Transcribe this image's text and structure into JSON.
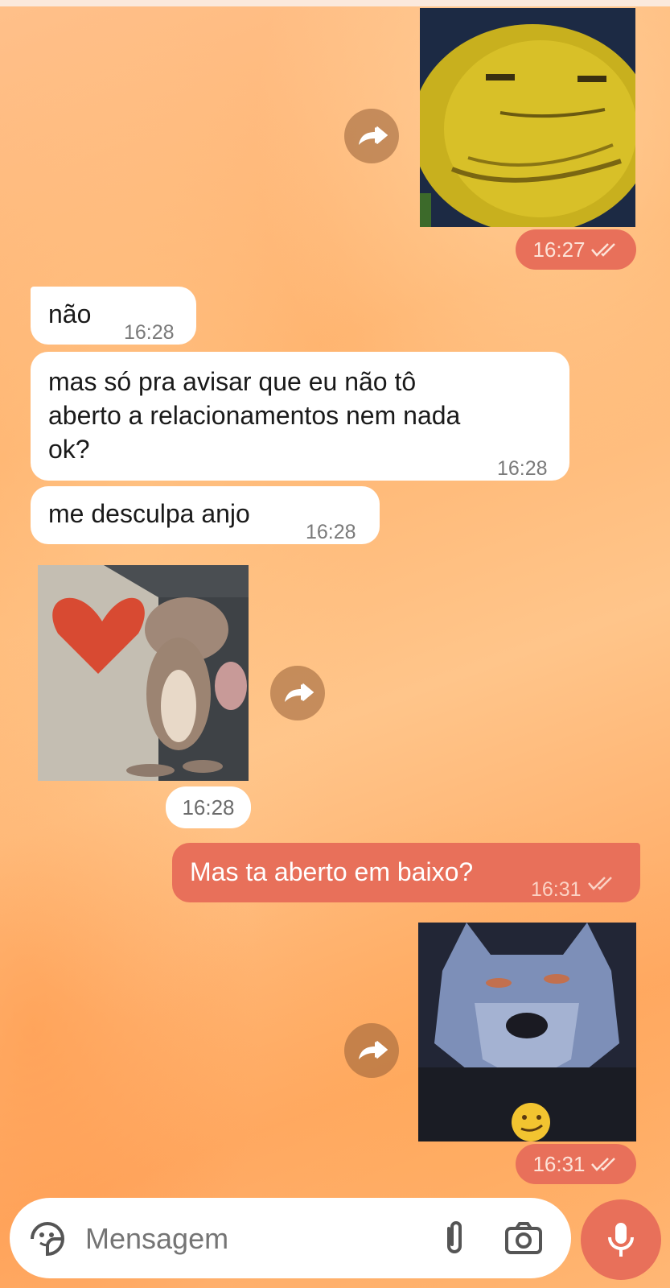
{
  "messages": [
    {
      "type": "sticker",
      "direction": "out",
      "name": "yellow-face-sticker",
      "time": "16:27",
      "status": "read"
    },
    {
      "type": "text",
      "direction": "in",
      "text": "não",
      "time": "16:28"
    },
    {
      "type": "text",
      "direction": "in",
      "lines": [
        "mas só pra avisar que eu não tô",
        "aberto a relacionamentos nem nada",
        "ok?"
      ],
      "time": "16:28"
    },
    {
      "type": "text",
      "direction": "in",
      "text": "me desculpa anjo",
      "time": "16:28"
    },
    {
      "type": "sticker",
      "direction": "in",
      "name": "jerry-heart-sticker",
      "time": "16:28"
    },
    {
      "type": "text",
      "direction": "out",
      "text": "Mas ta aberto em baixo?",
      "time": "16:31",
      "status": "read"
    },
    {
      "type": "sticker",
      "direction": "out",
      "name": "wolf-smirk-sticker",
      "time": "16:31",
      "status": "read"
    }
  ],
  "composer": {
    "placeholder": "Mensagem",
    "icons": [
      "sticker-icon",
      "attach-icon",
      "camera-icon",
      "mic-icon"
    ]
  },
  "colors": {
    "outgoing": "#e8705a",
    "incoming": "#ffffff",
    "background": "#ffb36e"
  }
}
